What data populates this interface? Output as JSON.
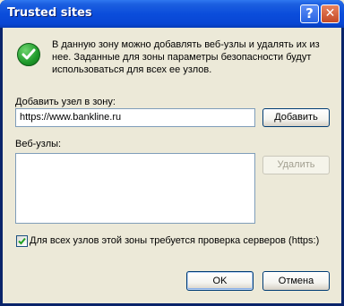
{
  "window": {
    "title": "Trusted sites"
  },
  "titlebar_buttons": {
    "help": "?",
    "close": "✕"
  },
  "info": {
    "icon": "green-check-icon",
    "text": "В данную зону можно добавлять веб-узлы и удалять их из нее. Заданные для зоны параметры безопасности будут использоваться для всех ее узлов."
  },
  "add_site": {
    "label": "Добавить узел в зону:",
    "value": "https://www.bankline.ru",
    "button": "Добавить"
  },
  "sites": {
    "label": "Веб-узлы:",
    "items": [],
    "remove_button": "Удалить"
  },
  "verification": {
    "checked": true,
    "label": "Для всех узлов этой зоны требуется проверка серверов (https:)"
  },
  "footer": {
    "ok": "OK",
    "cancel": "Отмена"
  },
  "colors": {
    "titlebar": "#0B4DDB",
    "face": "#ECE9D8",
    "border": "#7F9DB9",
    "check": "#21A121"
  }
}
